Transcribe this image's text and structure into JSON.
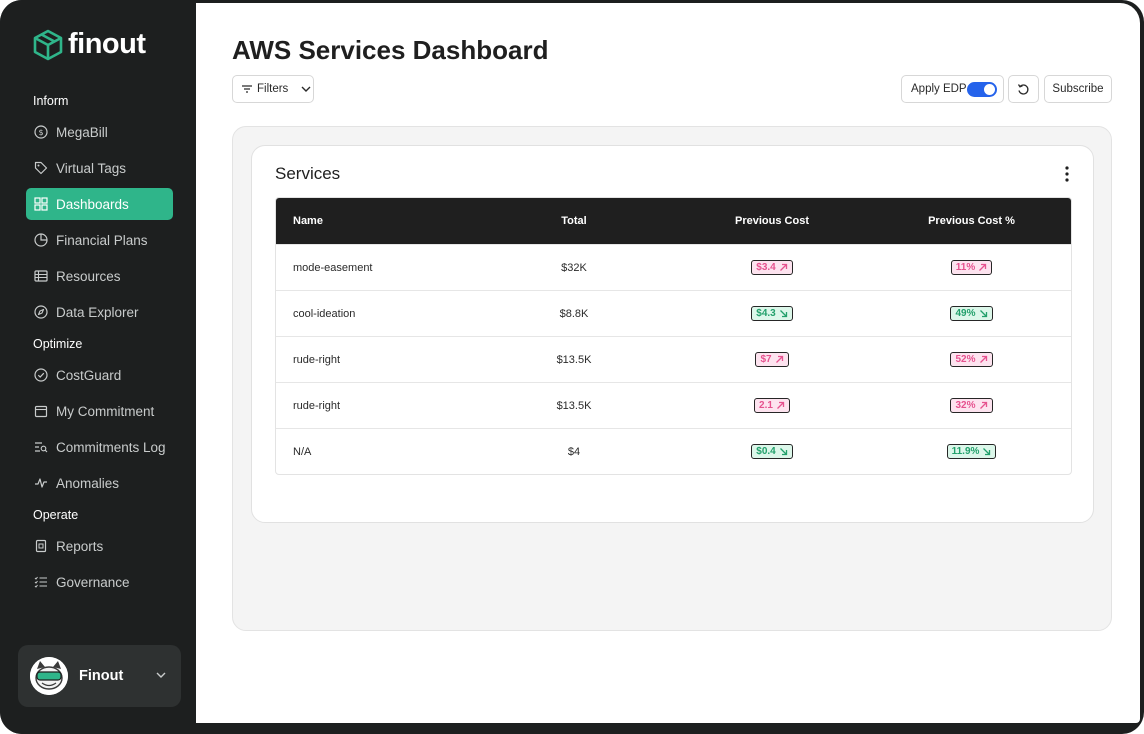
{
  "brand": {
    "name": "finout",
    "accent": "#2fb58a"
  },
  "sidebar": {
    "sections": [
      {
        "label": "Inform"
      },
      {
        "label": "Optimize"
      },
      {
        "label": "Operate"
      }
    ],
    "items": [
      {
        "label": "MegaBill",
        "icon": "dollar-circle-icon"
      },
      {
        "label": "Virtual Tags",
        "icon": "tag-icon"
      },
      {
        "label": "Dashboards",
        "icon": "grid-icon",
        "active": true
      },
      {
        "label": "Financial Plans",
        "icon": "pie-icon"
      },
      {
        "label": "Resources",
        "icon": "list-icon"
      },
      {
        "label": "Data Explorer",
        "icon": "compass-icon"
      },
      {
        "label": "CostGuard",
        "icon": "shield-check-icon"
      },
      {
        "label": "My Commitment",
        "icon": "calendar-icon"
      },
      {
        "label": "Commitments Log",
        "icon": "search-list-icon"
      },
      {
        "label": "Anomalies",
        "icon": "pulse-icon"
      },
      {
        "label": "Reports",
        "icon": "report-icon"
      },
      {
        "label": "Governance",
        "icon": "checklist-icon"
      }
    ],
    "account": {
      "name": "Finout"
    }
  },
  "header": {
    "title": "AWS Services Dashboard",
    "filters_label": "Filters",
    "apply_edp_label": "Apply EDP",
    "apply_edp_on": true,
    "subscribe_label": "Subscribe"
  },
  "card": {
    "title": "Services",
    "columns": [
      "Name",
      "Total",
      "Previous Cost",
      "Previous Cost %"
    ],
    "rows": [
      {
        "name": "mode-easement",
        "total": "$32K",
        "prev": "$3.4",
        "prev_dir": "up",
        "pct": "11%",
        "pct_dir": "up"
      },
      {
        "name": "cool-ideation",
        "total": "$8.8K",
        "prev": "$4.3",
        "prev_dir": "down",
        "pct": "49%",
        "pct_dir": "down"
      },
      {
        "name": "rude-right",
        "total": "$13.5K",
        "prev": "$7",
        "prev_dir": "up",
        "pct": "52%",
        "pct_dir": "up"
      },
      {
        "name": "rude-right",
        "total": "$13.5K",
        "prev": "2.1",
        "prev_dir": "up",
        "pct": "32%",
        "pct_dir": "up"
      },
      {
        "name": "N/A",
        "total": "$4",
        "prev": "$0.4",
        "prev_dir": "down",
        "pct": "11.9%",
        "pct_dir": "down"
      }
    ]
  },
  "colors": {
    "up_text": "#e6528f",
    "up_bg": "#fde3ef",
    "down_text": "#22a06b",
    "down_bg": "#dcf7ea",
    "toggle": "#2563eb"
  }
}
